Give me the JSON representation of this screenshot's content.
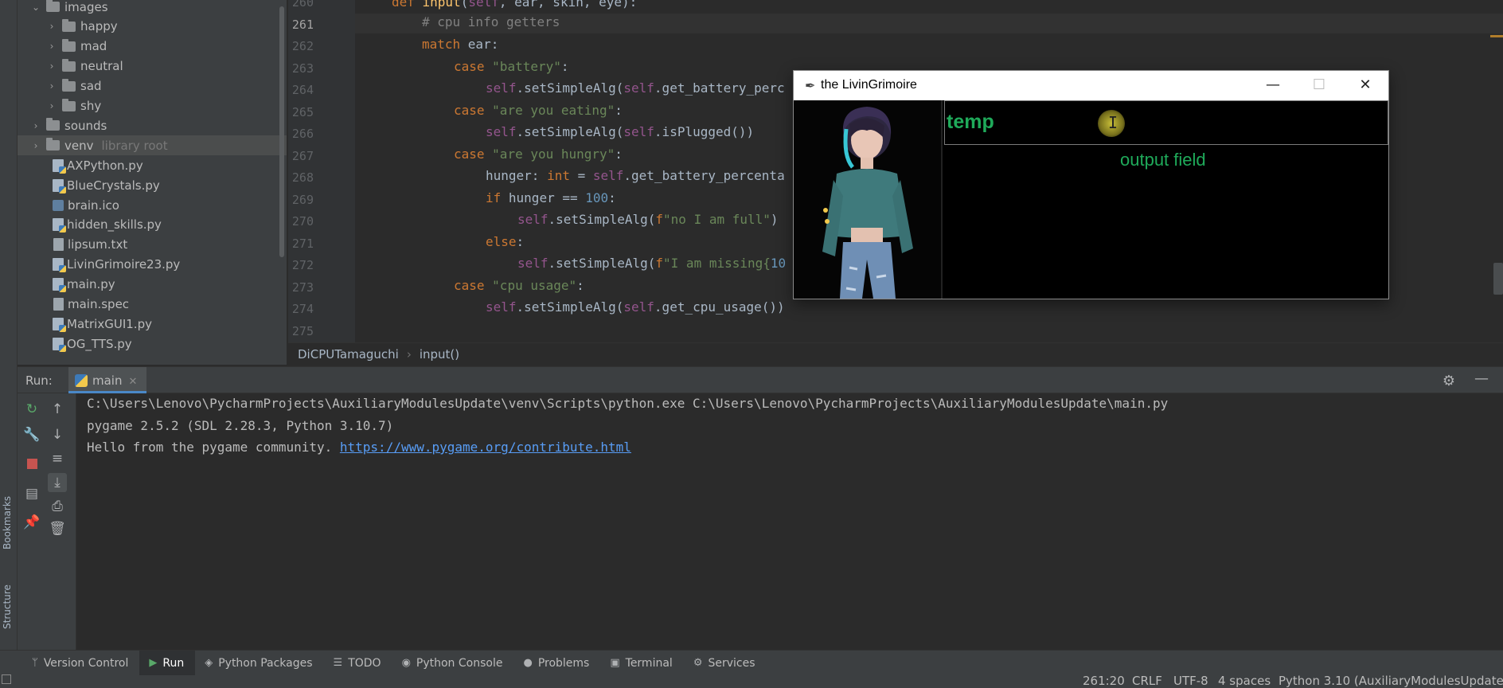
{
  "side_tabs": {
    "bookmarks": "Bookmarks",
    "structure": "Structure"
  },
  "project_tree": [
    {
      "label": "images",
      "type": "folder",
      "expanded": true,
      "depth": 1
    },
    {
      "label": "happy",
      "type": "folder",
      "depth": 2
    },
    {
      "label": "mad",
      "type": "folder",
      "depth": 2
    },
    {
      "label": "neutral",
      "type": "folder",
      "depth": 2
    },
    {
      "label": "sad",
      "type": "folder",
      "depth": 2
    },
    {
      "label": "shy",
      "type": "folder",
      "depth": 2
    },
    {
      "label": "sounds",
      "type": "folder",
      "depth": 1
    },
    {
      "label": "venv",
      "type": "folder",
      "depth": 1,
      "note": "library root",
      "selected": true
    },
    {
      "label": "AXPython.py",
      "type": "py",
      "depth": 1
    },
    {
      "label": "BlueCrystals.py",
      "type": "py",
      "depth": 1
    },
    {
      "label": "brain.ico",
      "type": "ico",
      "depth": 1
    },
    {
      "label": "hidden_skills.py",
      "type": "py",
      "depth": 1
    },
    {
      "label": "lipsum.txt",
      "type": "txt",
      "depth": 1
    },
    {
      "label": "LivinGrimoire23.py",
      "type": "py",
      "depth": 1
    },
    {
      "label": "main.py",
      "type": "py",
      "depth": 1
    },
    {
      "label": "main.spec",
      "type": "txt",
      "depth": 1
    },
    {
      "label": "MatrixGUI1.py",
      "type": "py",
      "depth": 1
    },
    {
      "label": "OG_TTS.py",
      "type": "py",
      "depth": 1
    }
  ],
  "editor": {
    "line_numbers": [
      "260",
      "261",
      "262",
      "263",
      "264",
      "265",
      "266",
      "267",
      "268",
      "269",
      "270",
      "271",
      "272",
      "273",
      "274",
      "275"
    ],
    "current_line": "261"
  },
  "breadcrumb": {
    "class": "DiCPUTamaguchi",
    "method": "input()"
  },
  "run_panel": {
    "label": "Run:",
    "tab": "main",
    "console_lines": [
      "C:\\Users\\Lenovo\\PycharmProjects\\AuxiliaryModulesUpdate\\venv\\Scripts\\python.exe C:\\Users\\Lenovo\\PycharmProjects\\AuxiliaryModulesUpdate\\main.py",
      "pygame 2.5.2 (SDL 2.28.3, Python 3.10.7)",
      "Hello from the pygame community. "
    ],
    "console_link": "https://www.pygame.org/contribute.html"
  },
  "tool_windows": [
    {
      "label": "Version Control",
      "icon": "version-control-icon"
    },
    {
      "label": "Run",
      "icon": "run-icon",
      "active": true
    },
    {
      "label": "Python Packages",
      "icon": "packages-icon"
    },
    {
      "label": "TODO",
      "icon": "todo-icon"
    },
    {
      "label": "Python Console",
      "icon": "python-console-icon"
    },
    {
      "label": "Problems",
      "icon": "problems-icon"
    },
    {
      "label": "Terminal",
      "icon": "terminal-icon"
    },
    {
      "label": "Services",
      "icon": "services-icon"
    }
  ],
  "status_bar": {
    "position": "261:20",
    "line_ending": "CRLF",
    "encoding": "UTF-8",
    "indent": "4 spaces",
    "interpreter": "Python 3.10 (AuxiliaryModulesUpdate)"
  },
  "tk_window": {
    "title": "the LivinGrimoire",
    "input_text": "temp",
    "output_label": "output field",
    "colors": {
      "text": "#1faa5a",
      "background": "#000000"
    }
  }
}
